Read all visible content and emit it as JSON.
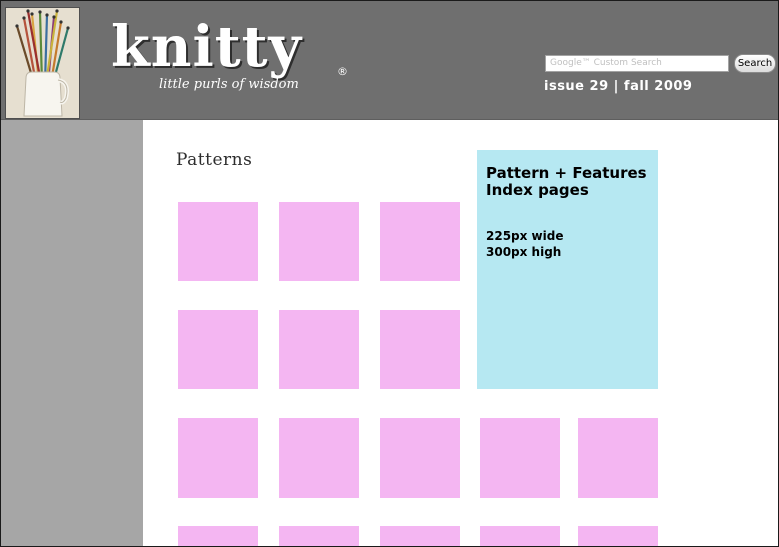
{
  "header": {
    "logo_text": "knitty",
    "registered_mark": "®",
    "tagline": "little purls of wisdom",
    "issue": "issue 29 | fall 2009"
  },
  "search": {
    "placeholder": "Google™ Custom Search",
    "button_label": "Search"
  },
  "main": {
    "section_title": "Patterns",
    "feature_box": {
      "title": "Pattern + Features Index pages",
      "spec": "225px wide\n300px high"
    }
  },
  "colors": {
    "header_bg": "#6f6f6f",
    "sidebar_bg": "#a6a6a6",
    "thumbnail_placeholder": "#f4b6f2",
    "feature_box_bg": "#b6e8f2"
  }
}
